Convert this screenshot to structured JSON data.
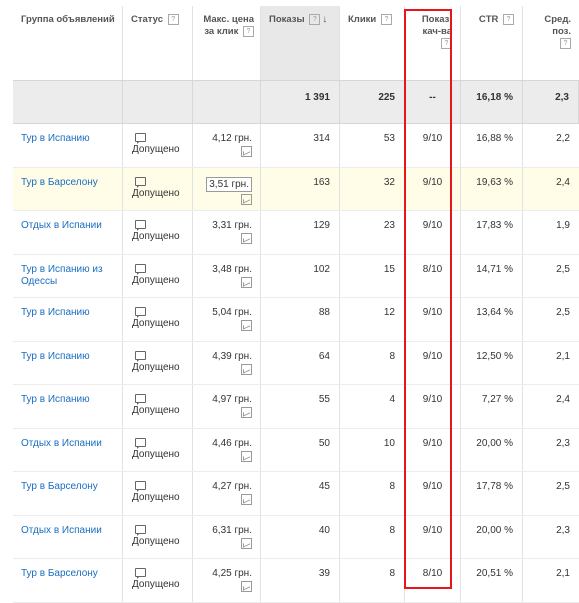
{
  "columns": {
    "group": "Группа объявлений",
    "status": "Статус",
    "max_bid": "Макс. цена за клик",
    "impressions": "Показы",
    "clicks": "Клики",
    "quality": "Показ. кач-ва",
    "ctr": "CTR",
    "avg_pos": "Сред. поз.",
    "help_glyph": "?",
    "sort_glyph": "↓"
  },
  "totals": {
    "impressions": "1 391",
    "clicks": "225",
    "quality": "--",
    "ctr": "16,18 %",
    "avg_pos": "2,3"
  },
  "rows": [
    {
      "group": "Тур в Испанию",
      "status": "Допущено",
      "bid": "4,12 грн.",
      "impressions": "314",
      "clicks": "53",
      "quality": "9/10",
      "ctr": "16,88 %",
      "avg_pos": "2,2"
    },
    {
      "group": "Тур в Барселону",
      "status": "Допущено",
      "bid": "3,51 грн.",
      "impressions": "163",
      "clicks": "32",
      "quality": "9/10",
      "ctr": "19,63 %",
      "avg_pos": "2,4"
    },
    {
      "group": "Отдых в Испании",
      "status": "Допущено",
      "bid": "3,31 грн.",
      "impressions": "129",
      "clicks": "23",
      "quality": "9/10",
      "ctr": "17,83 %",
      "avg_pos": "1,9"
    },
    {
      "group": "Тур в Испанию из Одессы",
      "status": "Допущено",
      "bid": "3,48 грн.",
      "impressions": "102",
      "clicks": "15",
      "quality": "8/10",
      "ctr": "14,71 %",
      "avg_pos": "2,5"
    },
    {
      "group": "Тур в Испанию",
      "status": "Допущено",
      "bid": "5,04 грн.",
      "impressions": "88",
      "clicks": "12",
      "quality": "9/10",
      "ctr": "13,64 %",
      "avg_pos": "2,5"
    },
    {
      "group": "Тур в Испанию",
      "status": "Допущено",
      "bid": "4,39 грн.",
      "impressions": "64",
      "clicks": "8",
      "quality": "9/10",
      "ctr": "12,50 %",
      "avg_pos": "2,1"
    },
    {
      "group": "Тур в Испанию",
      "status": "Допущено",
      "bid": "4,97 грн.",
      "impressions": "55",
      "clicks": "4",
      "quality": "9/10",
      "ctr": "7,27 %",
      "avg_pos": "2,4"
    },
    {
      "group": "Отдых в Испании",
      "status": "Допущено",
      "bid": "4,46 грн.",
      "impressions": "50",
      "clicks": "10",
      "quality": "9/10",
      "ctr": "20,00 %",
      "avg_pos": "2,3"
    },
    {
      "group": "Тур в Барселону",
      "status": "Допущено",
      "bid": "4,27 грн.",
      "impressions": "45",
      "clicks": "8",
      "quality": "9/10",
      "ctr": "17,78 %",
      "avg_pos": "2,5"
    },
    {
      "group": "Отдых в Испании",
      "status": "Допущено",
      "bid": "6,31 грн.",
      "impressions": "40",
      "clicks": "8",
      "quality": "9/10",
      "ctr": "20,00 %",
      "avg_pos": "2,3"
    },
    {
      "group": "Тур в Барселону",
      "status": "Допущено",
      "bid": "4,25 грн.",
      "impressions": "39",
      "clicks": "8",
      "quality": "8/10",
      "ctr": "20,51 %",
      "avg_pos": "2,1"
    }
  ],
  "colors": {
    "link": "#1a6ebf",
    "highlight_box": "#e8161b",
    "row_highlight": "#fffde8"
  },
  "icons": {
    "status": "speech-bubble-icon",
    "bid_chart": "bid-chart-icon",
    "help": "help-icon",
    "sort": "sort-desc-icon"
  }
}
